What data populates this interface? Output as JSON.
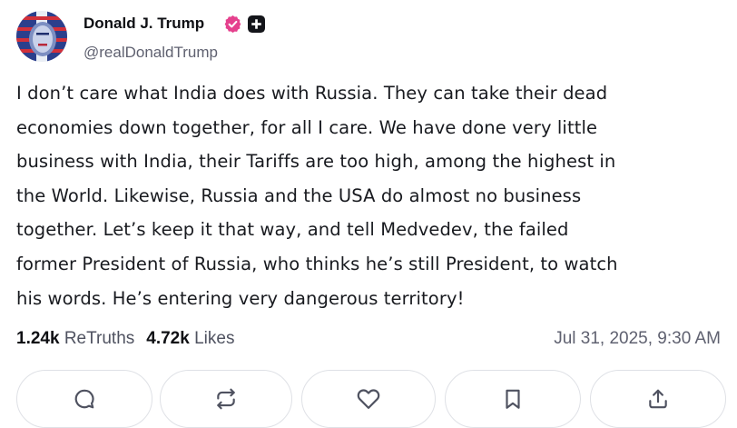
{
  "profile": {
    "display_name": "Donald J. Trump",
    "handle": "@realDonaldTrump",
    "avatar_icon": "avatar-image",
    "verified_icon": "verified-badge-icon",
    "verified_color": "#e5408d",
    "plus_icon": "plus-badge-icon"
  },
  "post": {
    "lines": [
      "I don’t care what India does with Russia. They can take their dead",
      "economies down together, for all I care. We have done very little",
      "business with India, their Tariffs are too high, among the highest in",
      "the World. Likewise, Russia and the USA do almost no business",
      "together. Let’s keep it that way, and tell Medvedev, the failed",
      "former President of Russia, who thinks he’s still President, to watch",
      "his words. He’s entering very dangerous territory!"
    ]
  },
  "stats": {
    "retruths_count": "1.24k",
    "retruths_label": "ReTruths",
    "likes_count": "4.72k",
    "likes_label": "Likes"
  },
  "timestamp": "Jul 31, 2025, 9:30 AM",
  "actions": [
    {
      "name": "reply",
      "icon": "comment-icon"
    },
    {
      "name": "retruth",
      "icon": "repost-icon"
    },
    {
      "name": "like",
      "icon": "heart-icon"
    },
    {
      "name": "bookmark",
      "icon": "bookmark-icon"
    },
    {
      "name": "share",
      "icon": "share-icon"
    }
  ],
  "colors": {
    "text": "#181a1f",
    "muted": "#5f6170",
    "border": "#dfe1e6",
    "icon": "#4f5260"
  }
}
